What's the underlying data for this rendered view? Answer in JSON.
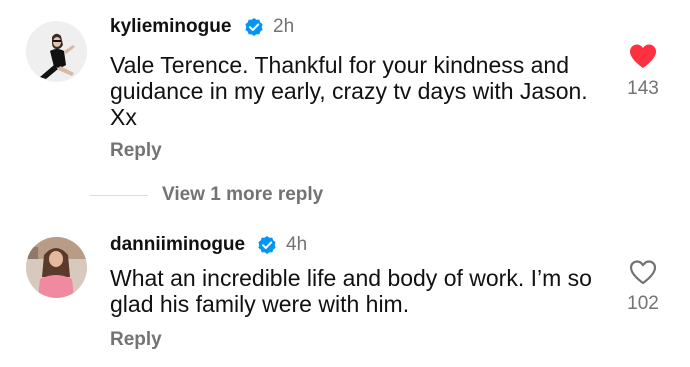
{
  "comments": [
    {
      "username": "kylieminogue",
      "time": "2h",
      "text": "Vale Terence. Thankful for your kindness and guidance in my early, crazy tv days with Jason. Xx",
      "reply_label": "Reply",
      "likes": "143",
      "liked": true,
      "verified": true,
      "like_icon": "heart-filled-icon"
    },
    {
      "username": "danniiminogue",
      "time": "4h",
      "text": "What an incredible life and body of work. I’m so glad his family were with him.",
      "reply_label": "Reply",
      "likes": "102",
      "liked": false,
      "verified": true,
      "like_icon": "heart-outline-icon"
    }
  ],
  "more_replies_label": "View 1 more reply",
  "colors": {
    "verified_blue": "#0095f6",
    "liked_red": "#ff3040",
    "secondary_text": "#737373"
  }
}
